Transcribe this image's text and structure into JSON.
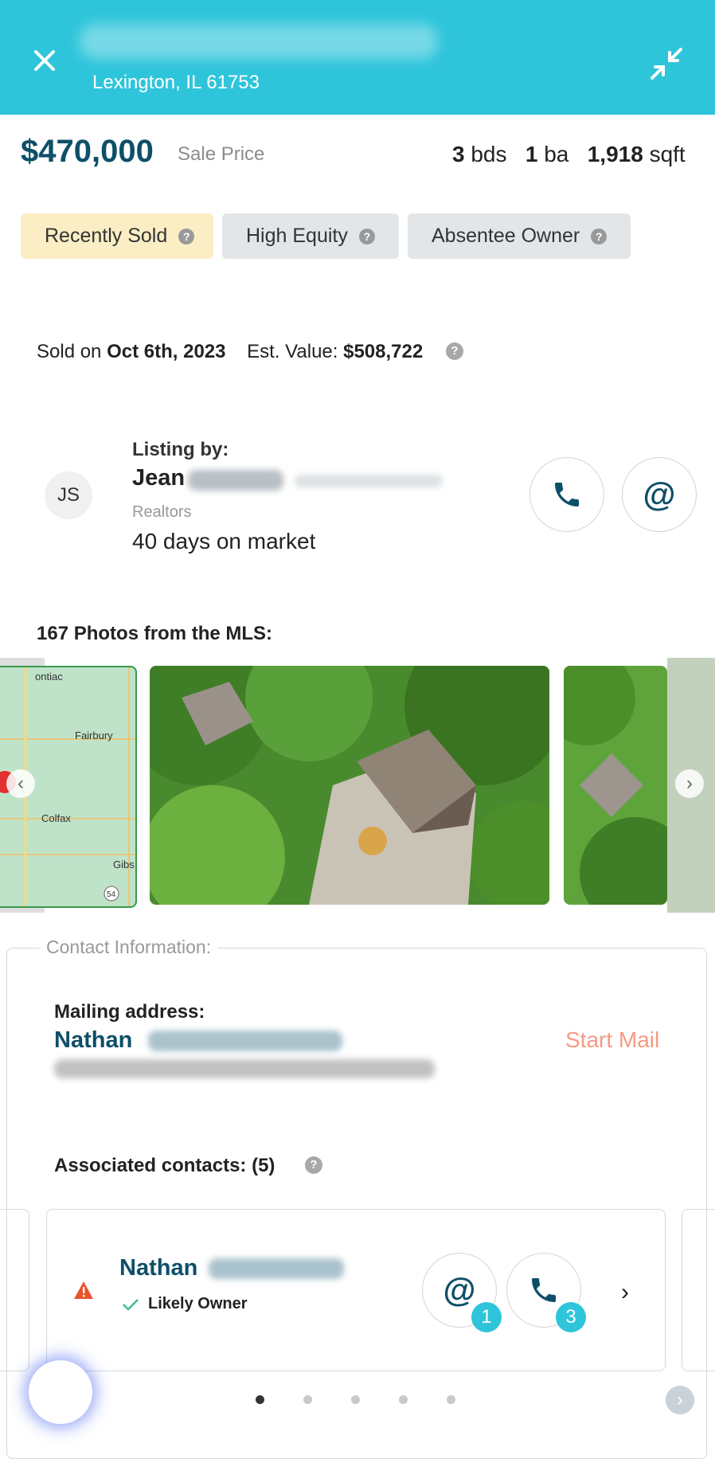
{
  "header": {
    "subtitle": "Lexington, IL 61753",
    "close_icon": "close-icon",
    "collapse_icon": "collapse-icon",
    "bg_color": "#2ec5db"
  },
  "summary": {
    "price": "$470,000",
    "price_label": "Sale Price",
    "beds_value": "3",
    "beds_unit": "bds",
    "baths_value": "1",
    "baths_unit": "ba",
    "sqft_value": "1,918",
    "sqft_unit": "sqft"
  },
  "tags": [
    {
      "label": "Recently Sold",
      "help": "?"
    },
    {
      "label": "High Equity",
      "help": "?"
    },
    {
      "label": "Absentee Owner",
      "help": "?"
    }
  ],
  "sale": {
    "sold_prefix": "Sold on",
    "sold_date": "Oct 6th, 2023",
    "est_label": "Est. Value:",
    "est_value": "$508,722",
    "help": "?"
  },
  "listing": {
    "avatar_initials": "JS",
    "heading": "Listing by:",
    "agent_first_name": "Jean",
    "brokerage_type": "Realtors",
    "days_on_market": "40 days on market"
  },
  "photos": {
    "heading": "167 Photos from the MLS:",
    "map_labels": [
      "ontiac",
      "Fairbury",
      "Colfax",
      "Gibs",
      "54"
    ]
  },
  "contact": {
    "legend": "Contact Information:",
    "mailing_heading": "Mailing address:",
    "mailing_first_name": "Nathan",
    "start_mail": "Start Mail",
    "associated_heading": "Associated contacts: (5)",
    "help": "?",
    "card": {
      "first_name": "Nathan",
      "status": "Likely Owner",
      "email_count": "1",
      "phone_count": "3"
    },
    "pagination": {
      "total": 5,
      "active": 1
    }
  },
  "colors": {
    "accent": "#2ec5db",
    "brand_dark": "#0e4f68",
    "start_mail": "#f59a84",
    "warning": "#e8552d",
    "check": "#3bbf8a"
  }
}
